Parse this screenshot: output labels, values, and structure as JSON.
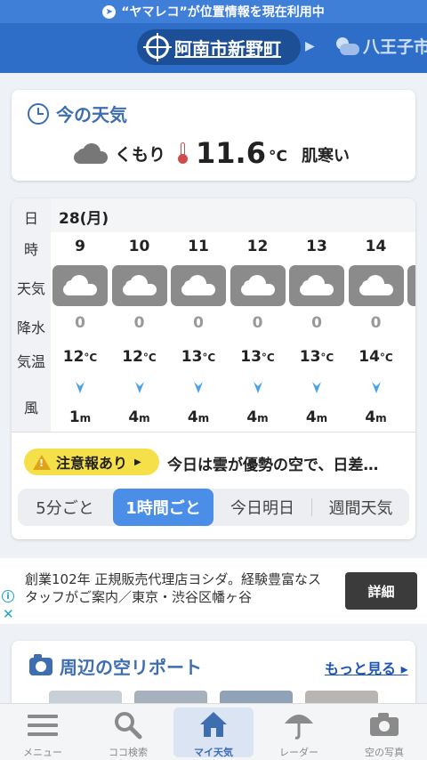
{
  "status_bar": {
    "text": "“ヤマレコ”が位置情報を現在利用中"
  },
  "header": {
    "current_location": "阿南市新野町",
    "next_location": "八王子市"
  },
  "now": {
    "title": "今の天気",
    "condition": "くもり",
    "temperature": "11.6",
    "unit": "°C",
    "feel": "肌寒い"
  },
  "hourly": {
    "row_labels": {
      "day": "日",
      "hour": "時",
      "weather": "天気",
      "precip": "降水",
      "temp": "気温",
      "wind": "風"
    },
    "date": "28(月)",
    "temp_unit": "°C",
    "wind_unit": "m",
    "hours": [
      {
        "hour": "9",
        "precip": "0",
        "temp": "12",
        "wind": "1"
      },
      {
        "hour": "10",
        "precip": "0",
        "temp": "12",
        "wind": "4"
      },
      {
        "hour": "11",
        "precip": "0",
        "temp": "13",
        "wind": "4"
      },
      {
        "hour": "12",
        "precip": "0",
        "temp": "13",
        "wind": "4"
      },
      {
        "hour": "13",
        "precip": "0",
        "temp": "13",
        "wind": "4"
      },
      {
        "hour": "14",
        "precip": "0",
        "temp": "14",
        "wind": "4"
      }
    ]
  },
  "warning": {
    "badge": "注意報あり",
    "text": "今日は雲が優勢の空で、日差…"
  },
  "tabs": [
    {
      "label": "5分ごと"
    },
    {
      "label": "1時間ごと"
    },
    {
      "label": "今日明日"
    },
    {
      "label": "週間天気"
    }
  ],
  "ad": {
    "text": "創業102年 正規販売代理店ヨシダ。経験豊富なスタッフがご案内／東京・渋谷区幡ヶ谷",
    "button": "詳細"
  },
  "report": {
    "title": "周辺の空リポート",
    "more": "もっと見る"
  },
  "nav": [
    {
      "label": "メニュー"
    },
    {
      "label": "ココ検索"
    },
    {
      "label": "マイ天気"
    },
    {
      "label": "レーダー"
    },
    {
      "label": "空の写真"
    }
  ],
  "colors": {
    "header": "#2e6ec9",
    "accent": "#3f6db1",
    "tab_active": "#4a8ee8",
    "warning": "#f6e04a",
    "arrow": "#4aa3e8"
  }
}
